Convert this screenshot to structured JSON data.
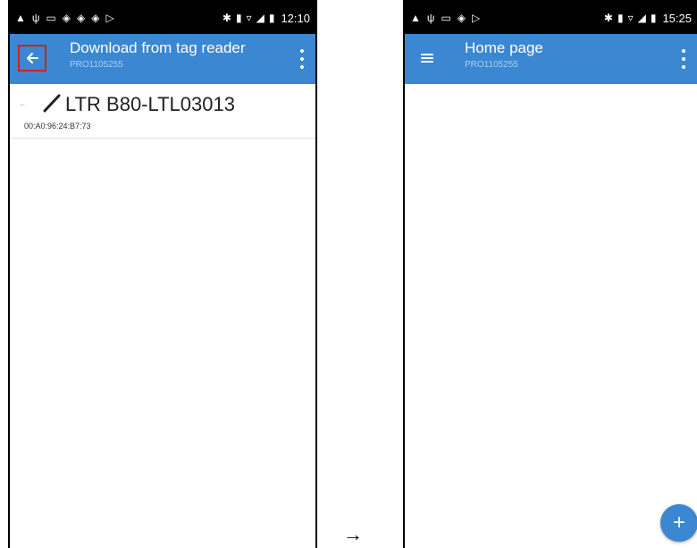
{
  "colors": {
    "accent": "#3b87d1",
    "subtitle": "#a9d0f2",
    "highlight": "#d11f1f"
  },
  "left_screen": {
    "status_bar": {
      "time": "12:10"
    },
    "app_bar": {
      "title": "Download from tag reader",
      "subtitle": "PRO1105255",
      "nav_icon": "back-arrow-icon"
    },
    "device": {
      "name": "LTR B80-LTL03013",
      "mac": "00:A0:96:24:B7:73"
    }
  },
  "separator": "→",
  "right_screen": {
    "status_bar": {
      "time": "15:25"
    },
    "app_bar": {
      "title": "Home page",
      "subtitle": "PRO1105255",
      "nav_icon": "menu-icon"
    },
    "fab": {
      "label": "+"
    }
  }
}
